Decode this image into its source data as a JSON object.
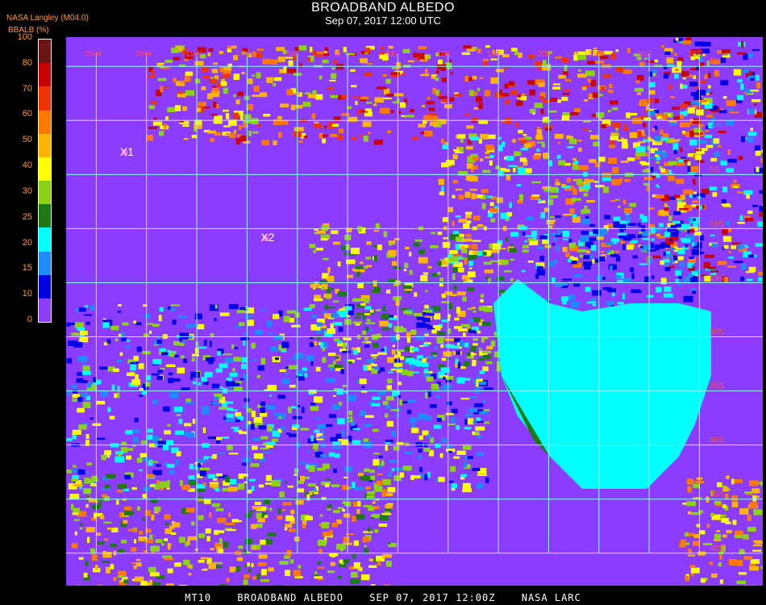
{
  "header": {
    "title": "BROADBAND ALBEDO",
    "subtitle": "Sep 07, 2017 12:00 UTC",
    "source": "NASA Langley (M04.0)",
    "variable": "BBALB (%)"
  },
  "colorbar": {
    "ticks": [
      "100",
      "80",
      "70",
      "60",
      "50",
      "40",
      "30",
      "25",
      "20",
      "15",
      "10",
      "0"
    ],
    "colors": [
      "#6e1414",
      "#c80000",
      "#f03200",
      "#ff7800",
      "#ffb400",
      "#ffff00",
      "#8cd214",
      "#1e7814",
      "#00ffff",
      "#1e8cff",
      "#0000e6",
      "#8c3cff"
    ]
  },
  "map": {
    "ocean_color": "#8c3cff",
    "land_color": "#00ffff",
    "grid_color": "#8cffff",
    "markers": [
      {
        "label": "X1",
        "lon": -22,
        "lat": -2.6
      },
      {
        "label": "X2",
        "lon": -8,
        "lat": -10.5
      }
    ],
    "lon_labels": [
      "25W",
      "20W",
      "15W",
      "10W",
      "5W",
      "0",
      "5E",
      "10E",
      "15E",
      "20E",
      "25E",
      "30E",
      "35E"
    ],
    "lat_labels": [
      "5N",
      "0",
      "5S",
      "10S",
      "15S",
      "20S",
      "25S",
      "30S",
      "35S",
      "40S"
    ]
  },
  "footer": {
    "instrument": "MT10",
    "product": "BROADBAND ALBEDO",
    "timestamp": "SEP 07, 2017 12:00Z",
    "agency": "NASA LARC"
  }
}
